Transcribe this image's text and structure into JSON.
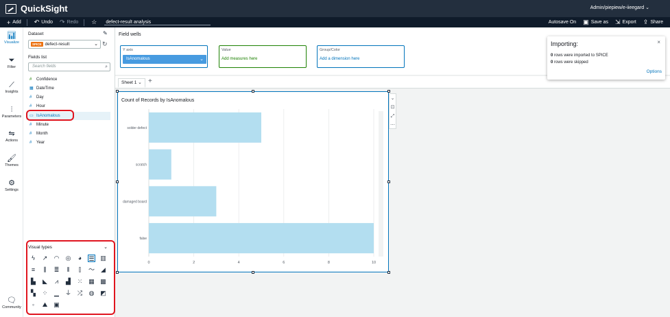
{
  "app": {
    "title": "QuickSight",
    "user": "Admin/piepiew/e-iieegard ⌄"
  },
  "toolbar": {
    "add_label": "Add",
    "undo_label": "Undo",
    "redo_label": "Redo",
    "analysis_name": "defect-result analysis",
    "autosave_label": "Autosave On",
    "save_as_label": "Save as",
    "export_label": "Export",
    "share_label": "Share"
  },
  "rail": [
    {
      "label": "Visualize",
      "icon": "bar-chart-icon",
      "active": true
    },
    {
      "label": "Filter",
      "icon": "filter-icon"
    },
    {
      "label": "Insights",
      "icon": "insights-icon"
    },
    {
      "label": "Parameters",
      "icon": "parameters-icon"
    },
    {
      "label": "Actions",
      "icon": "actions-icon"
    },
    {
      "label": "Themes",
      "icon": "brush-icon"
    },
    {
      "label": "Settings",
      "icon": "gear-icon"
    },
    {
      "label": "Community",
      "icon": "community-icon"
    }
  ],
  "panel": {
    "dataset_label": "Dataset",
    "dataset_badge": "SPICE",
    "dataset_name": "defect-result",
    "fields_label": "Fields list",
    "search_placeholder": "Search fields",
    "fields": [
      {
        "name": "Confidence",
        "type": "measure"
      },
      {
        "name": "DateTime",
        "type": "date"
      },
      {
        "name": "Day",
        "type": "dimension"
      },
      {
        "name": "Hour",
        "type": "dimension"
      },
      {
        "name": "IsAnomalous",
        "type": "dimension",
        "selected": true
      },
      {
        "name": "Minute",
        "type": "dimension"
      },
      {
        "name": "Month",
        "type": "dimension"
      },
      {
        "name": "Year",
        "type": "dimension"
      }
    ],
    "visual_types_label": "Visual types"
  },
  "field_wells": {
    "label": "Field wells",
    "y_axis_label": "Y axis",
    "y_axis_value": "IsAnomalous",
    "value_label": "Value",
    "value_add": "Add measures here",
    "group_label": "Group/Color",
    "group_add": "Add a dimension here"
  },
  "sheet": {
    "tab_label": "Sheet 1"
  },
  "visual": {
    "title": "Count of Records by IsAnomalous"
  },
  "popup": {
    "title": "Importing:",
    "imported_count": "0",
    "imported_text": "rows were imported to SPICE",
    "skipped_count": "0",
    "skipped_text": "rows were skipped",
    "options_label": "Options"
  },
  "chart_data": {
    "type": "bar",
    "orientation": "horizontal",
    "categories": [
      "solder defect",
      "scratch",
      "damaged board",
      "false"
    ],
    "values": [
      5,
      1,
      3,
      10
    ],
    "xlim": [
      0,
      10
    ],
    "x_ticks": [
      0,
      2,
      4,
      6,
      8,
      10
    ],
    "bar_color": "#b3def0",
    "grid": true,
    "title": "Count of Records by IsAnomalous",
    "xlabel": "",
    "ylabel": ""
  },
  "colors": {
    "topbar": "#232f3e",
    "accent": "#0073bb",
    "highlight": "#e0141e",
    "spice": "#ec7211"
  }
}
